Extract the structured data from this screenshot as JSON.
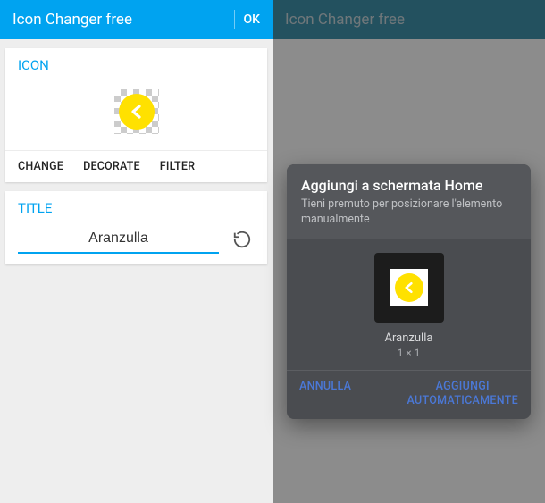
{
  "left": {
    "app_title": "Icon Changer free",
    "ok_label": "OK",
    "icon_section_label": "ICON",
    "tabs": {
      "change": "CHANGE",
      "decorate": "DECORATE",
      "filter": "FILTER"
    },
    "title_section_label": "TITLE",
    "title_value": "Aranzulla"
  },
  "right": {
    "app_title": "Icon Changer free",
    "dialog": {
      "title": "Aggiungi a schermata Home",
      "subtitle": "Tieni premuto per posizionare l'elemento manualmente",
      "shortcut_name": "Aranzulla",
      "shortcut_size": "1 × 1",
      "cancel": "ANNULLA",
      "add_auto_line1": "AGGIUNGI",
      "add_auto_line2": "AUTOMATICAMENTE"
    }
  }
}
